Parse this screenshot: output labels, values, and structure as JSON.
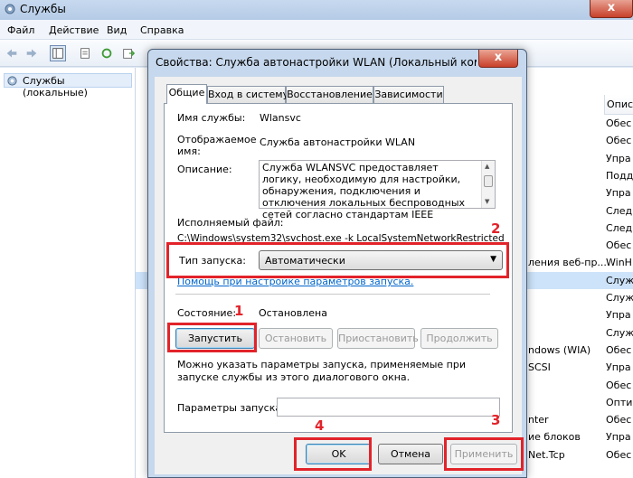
{
  "bg_window": {
    "title": "Службы",
    "menu": [
      "Файл",
      "Действие",
      "Вид",
      "Справка"
    ],
    "tree_item": "Службы (локальные)",
    "col_header": "Опис",
    "rows": [
      {
        "name": "",
        "desc": "Обес"
      },
      {
        "name": "",
        "desc": "Обес"
      },
      {
        "name": "",
        "desc": "Упра"
      },
      {
        "name": "",
        "desc": "Подд"
      },
      {
        "name": "",
        "desc": "Упра"
      },
      {
        "name": "",
        "desc": "След"
      },
      {
        "name": "",
        "desc": "След"
      },
      {
        "name": "",
        "desc": "Обес"
      },
      {
        "name": "ления веб-пр...",
        "desc": "WinH"
      },
      {
        "name": "",
        "desc": "Служ"
      },
      {
        "name": "",
        "desc": "Служ"
      },
      {
        "name": "",
        "desc": "Упра"
      },
      {
        "name": "",
        "desc": "Служ"
      },
      {
        "name": "ndows (WIA)",
        "desc": "Обес"
      },
      {
        "name": "SCSI",
        "desc": "Упра"
      },
      {
        "name": "",
        "desc": "Обес"
      },
      {
        "name": "",
        "desc": "Опти"
      },
      {
        "name": "nter",
        "desc": "Обес"
      },
      {
        "name": "ие блоков",
        "desc": "Упра"
      },
      {
        "name": "Net.Tcp",
        "desc": "Обес"
      }
    ]
  },
  "dialog": {
    "title": "Свойства: Служба автонастройки WLAN (Локальный компьют...",
    "close_glyph": "x",
    "tabs": [
      "Общие",
      "Вход в систему",
      "Восстановление",
      "Зависимости"
    ],
    "service_name_label": "Имя службы:",
    "service_name": "Wlansvc",
    "display_name_label_1": "Отображаемое",
    "display_name_label_2": "имя:",
    "display_name": "Служба автонастройки WLAN",
    "description_label": "Описание:",
    "description": "Служба WLANSVC предоставляет логику, необходимую для настройки, обнаружения, подключения и отключения локальных беспроводных сетей согласно стандартам IEEE",
    "exe_label": "Исполняемый файл:",
    "exe_path": "C:\\Windows\\system32\\svchost.exe -k LocalSystemNetworkRestricted",
    "startup_label": "Тип запуска:",
    "startup_value": "Автоматически",
    "help_link": "Помощь при настройке параметров запуска.",
    "state_label": "Состояние:",
    "state_value": "Остановлена",
    "btn_start": "Запустить",
    "btn_stop": "Остановить",
    "btn_pause": "Приостановить",
    "btn_resume": "Продолжить",
    "hint": "Можно указать параметры запуска, применяемые при запуске службы из этого диалогового окна.",
    "params_label": "Параметры запуска:",
    "params_value": "",
    "btn_ok": "OK",
    "btn_cancel": "Отмена",
    "btn_apply": "Применить"
  },
  "annotations": {
    "n1": "1",
    "n2": "2",
    "n3": "3",
    "n4": "4",
    "color": "#e2232a"
  }
}
